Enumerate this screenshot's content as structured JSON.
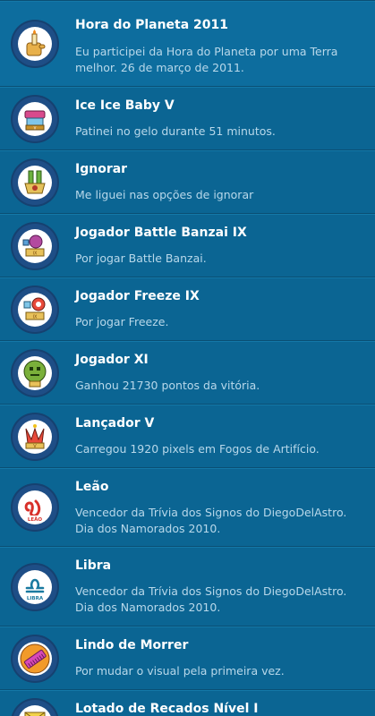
{
  "achievements": [
    {
      "title": "Hora do Planeta 2011",
      "description": "Eu participei da Hora do Planeta por uma Terra melhor. 26 de março de 2011.",
      "icon": "hand-candle-badge-icon"
    },
    {
      "title": "Ice Ice Baby V",
      "description": "Patinei no gelo durante 51 minutos.",
      "icon": "ice-skating-badge-icon"
    },
    {
      "title": "Ignorar",
      "description": "Me liguei nas opções de ignorar",
      "icon": "ignore-badge-icon"
    },
    {
      "title": "Jogador Battle Banzai IX",
      "description": "Por jogar Battle Banzai.",
      "icon": "battle-banzai-badge-icon"
    },
    {
      "title": "Jogador Freeze IX",
      "description": "Por jogar Freeze.",
      "icon": "freeze-badge-icon"
    },
    {
      "title": "Jogador XI",
      "description": "Ganhou 21730 pontos da vitória.",
      "icon": "player-badge-icon"
    },
    {
      "title": "Lançador V",
      "description": "Carregou 1920 pixels em Fogos de Artifício.",
      "icon": "fireworks-badge-icon"
    },
    {
      "title": "Leão",
      "description": "Vencedor da Trívia dos Signos do DiegoDelAstro. Dia dos Namorados 2010.",
      "icon": "leo-sign-badge-icon",
      "badge_text": "LEÃO"
    },
    {
      "title": "Libra",
      "description": "Vencedor da Trívia dos Signos do DiegoDelAstro. Dia dos Namorados 2010.",
      "icon": "libra-sign-badge-icon",
      "badge_text": "LIBRA"
    },
    {
      "title": "Lindo de Morrer",
      "description": "Por mudar o visual pela primeira vez.",
      "icon": "comb-badge-icon"
    },
    {
      "title": "Lotado de Recados Nível I",
      "description": "",
      "icon": "messages-badge-icon"
    }
  ]
}
